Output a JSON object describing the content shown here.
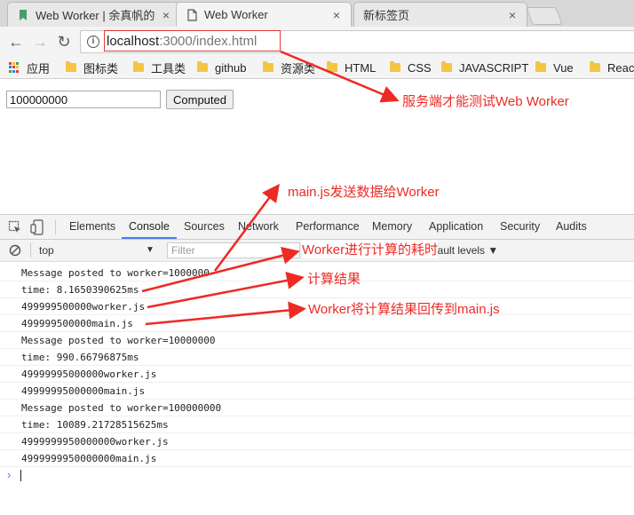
{
  "tabs": [
    {
      "title": "Web Worker | 余真帆的",
      "close": "×"
    },
    {
      "title": "Web Worker",
      "close": "×"
    },
    {
      "title": "新标签页",
      "close": "×"
    }
  ],
  "toolbar": {
    "back_icon": "←",
    "forward_icon": "→",
    "reload_icon": "↻",
    "info_icon": "i",
    "url_host": "localhost",
    "url_rest": ":3000/index.html"
  },
  "bookmarks": [
    "应用",
    "图标类",
    "工具类",
    "github",
    "资源类",
    "HTML",
    "CSS",
    "JAVASCRIPT",
    "Vue",
    "React"
  ],
  "page": {
    "input_value": "100000000",
    "button_label": "Computed"
  },
  "devtools": {
    "tabs": [
      "Elements",
      "Console",
      "Sources",
      "Network",
      "Performance",
      "Memory",
      "Application",
      "Security",
      "Audits"
    ],
    "active_tab": "Console",
    "context": "top",
    "filter_placeholder": "Filter",
    "levels": "Default levels ▼"
  },
  "console_lines": [
    "Message posted to worker=1000000",
    "time: 8.1650390625ms",
    "499999500000worker.js",
    "499999500000main.js",
    "Message posted to worker=10000000",
    "time: 990.66796875ms",
    "49999995000000worker.js",
    "49999995000000main.js",
    "Message posted to worker=100000000",
    "time: 10089.21728515625ms",
    "4999999950000000worker.js",
    "4999999950000000main.js"
  ],
  "annotations": {
    "server": "服务端才能测试Web Worker",
    "mainjs": "main.js发送数据给Worker",
    "worker_time": "Worker进行计算的耗时",
    "result": "计算结果",
    "returned": "Worker将计算结果回传到main.js"
  },
  "colors": {
    "annotation": "#ee2a24",
    "accent": "#3e82f7",
    "folder": "#f5c542"
  }
}
